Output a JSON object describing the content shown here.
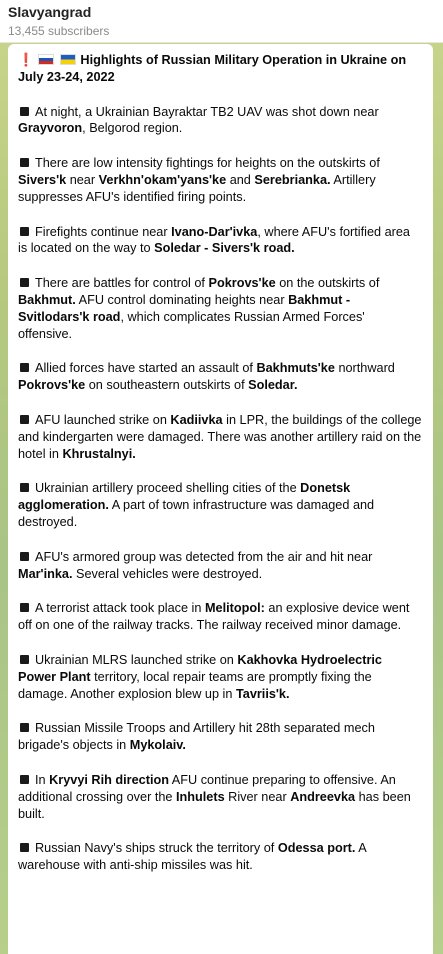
{
  "header": {
    "channel_name": "Slavyangrad",
    "subscribers": "13,455 subscribers"
  },
  "post": {
    "title_icons": [
      "exclamation-icon",
      "russia-flag-icon",
      "ukraine-flag-icon"
    ],
    "title": "Highlights of Russian Military Operation in Ukraine on July 23-24, 2022",
    "items": [
      {
        "segments": [
          {
            "t": "At night, a Ukrainian Bayraktar TB2 UAV was shot down near ",
            "b": false
          },
          {
            "t": "Grayvoron",
            "b": true
          },
          {
            "t": ", Belgorod region.",
            "b": false
          }
        ]
      },
      {
        "segments": [
          {
            "t": "There are low intensity fightings for heights on the outskirts of ",
            "b": false
          },
          {
            "t": "Sivers'k",
            "b": true
          },
          {
            "t": " near ",
            "b": false
          },
          {
            "t": "Verkhn'okam'yans'ke",
            "b": true
          },
          {
            "t": " and ",
            "b": false
          },
          {
            "t": "Serebrianka.",
            "b": true
          },
          {
            "t": " Artillery suppresses AFU's identified firing points.",
            "b": false
          }
        ]
      },
      {
        "segments": [
          {
            "t": "Firefights continue near ",
            "b": false
          },
          {
            "t": "Ivano-Dar'ivka",
            "b": true
          },
          {
            "t": ", where AFU's fortified area is located on the way to ",
            "b": false
          },
          {
            "t": "Soledar - Sivers'k road.",
            "b": true
          }
        ]
      },
      {
        "segments": [
          {
            "t": "There are battles for control of ",
            "b": false
          },
          {
            "t": "Pokrovs'ke",
            "b": true
          },
          {
            "t": " on the outskirts of ",
            "b": false
          },
          {
            "t": "Bakhmut.",
            "b": true
          },
          {
            "t": "  AFU control dominating heights near ",
            "b": false
          },
          {
            "t": "Bakhmut - Svitlodars'k road",
            "b": true
          },
          {
            "t": ", which complicates Russian Armed Forces' offensive.",
            "b": false
          }
        ]
      },
      {
        "segments": [
          {
            "t": "Allied forces have started an assault of ",
            "b": false
          },
          {
            "t": "Bakhmuts'ke",
            "b": true
          },
          {
            "t": " northward ",
            "b": false
          },
          {
            "t": "Pokrovs'ke",
            "b": true
          },
          {
            "t": " on southeastern outskirts of ",
            "b": false
          },
          {
            "t": "Soledar.",
            "b": true
          }
        ]
      },
      {
        "segments": [
          {
            "t": "AFU launched strike on ",
            "b": false
          },
          {
            "t": "Kadiivka",
            "b": true
          },
          {
            "t": " in LPR, the buildings of the college and kindergarten were damaged. There was another artillery raid on the hotel in ",
            "b": false
          },
          {
            "t": "Khrustalnyi.",
            "b": true
          }
        ]
      },
      {
        "segments": [
          {
            "t": "Ukrainian artillery proceed shelling cities of the ",
            "b": false
          },
          {
            "t": "Donetsk agglomeration.",
            "b": true
          },
          {
            "t": " A part of town infrastructure was damaged and destroyed.",
            "b": false
          }
        ]
      },
      {
        "segments": [
          {
            "t": "AFU's armored group was detected from the air and hit near ",
            "b": false
          },
          {
            "t": "Mar'inka.",
            "b": true
          },
          {
            "t": " Several vehicles were destroyed.",
            "b": false
          }
        ]
      },
      {
        "segments": [
          {
            "t": "A terrorist attack took place in ",
            "b": false
          },
          {
            "t": "Melitopol:",
            "b": true
          },
          {
            "t": " an explosive device went off on one of the railway tracks. The railway received minor damage.",
            "b": false
          }
        ]
      },
      {
        "segments": [
          {
            "t": "Ukrainian MLRS launched strike on ",
            "b": false
          },
          {
            "t": "Kakhovka Hydroelectric Power Plant",
            "b": true
          },
          {
            "t": " territory, local repair teams are promptly fixing the damage. Another explosion blew up in ",
            "b": false
          },
          {
            "t": "Tavriis'k.",
            "b": true
          }
        ]
      },
      {
        "segments": [
          {
            "t": "Russian Missile Troops and Artillery hit 28th separated mech brigade's objects in ",
            "b": false
          },
          {
            "t": "Mykolaiv.",
            "b": true
          }
        ]
      },
      {
        "segments": [
          {
            "t": "In ",
            "b": false
          },
          {
            "t": "Kryvyi Rih direction",
            "b": true
          },
          {
            "t": " AFU continue preparing to offensive. An additional crossing over the ",
            "b": false
          },
          {
            "t": "Inhulets",
            "b": true
          },
          {
            "t": " River near ",
            "b": false
          },
          {
            "t": "Andreevka",
            "b": true
          },
          {
            "t": " has been built.",
            "b": false
          }
        ]
      },
      {
        "segments": [
          {
            "t": "Russian Navy's ships struck the territory of ",
            "b": false
          },
          {
            "t": "Odessa port.",
            "b": true
          },
          {
            "t": " A warehouse with anti-ship missiles was hit.",
            "b": false
          }
        ]
      }
    ]
  }
}
